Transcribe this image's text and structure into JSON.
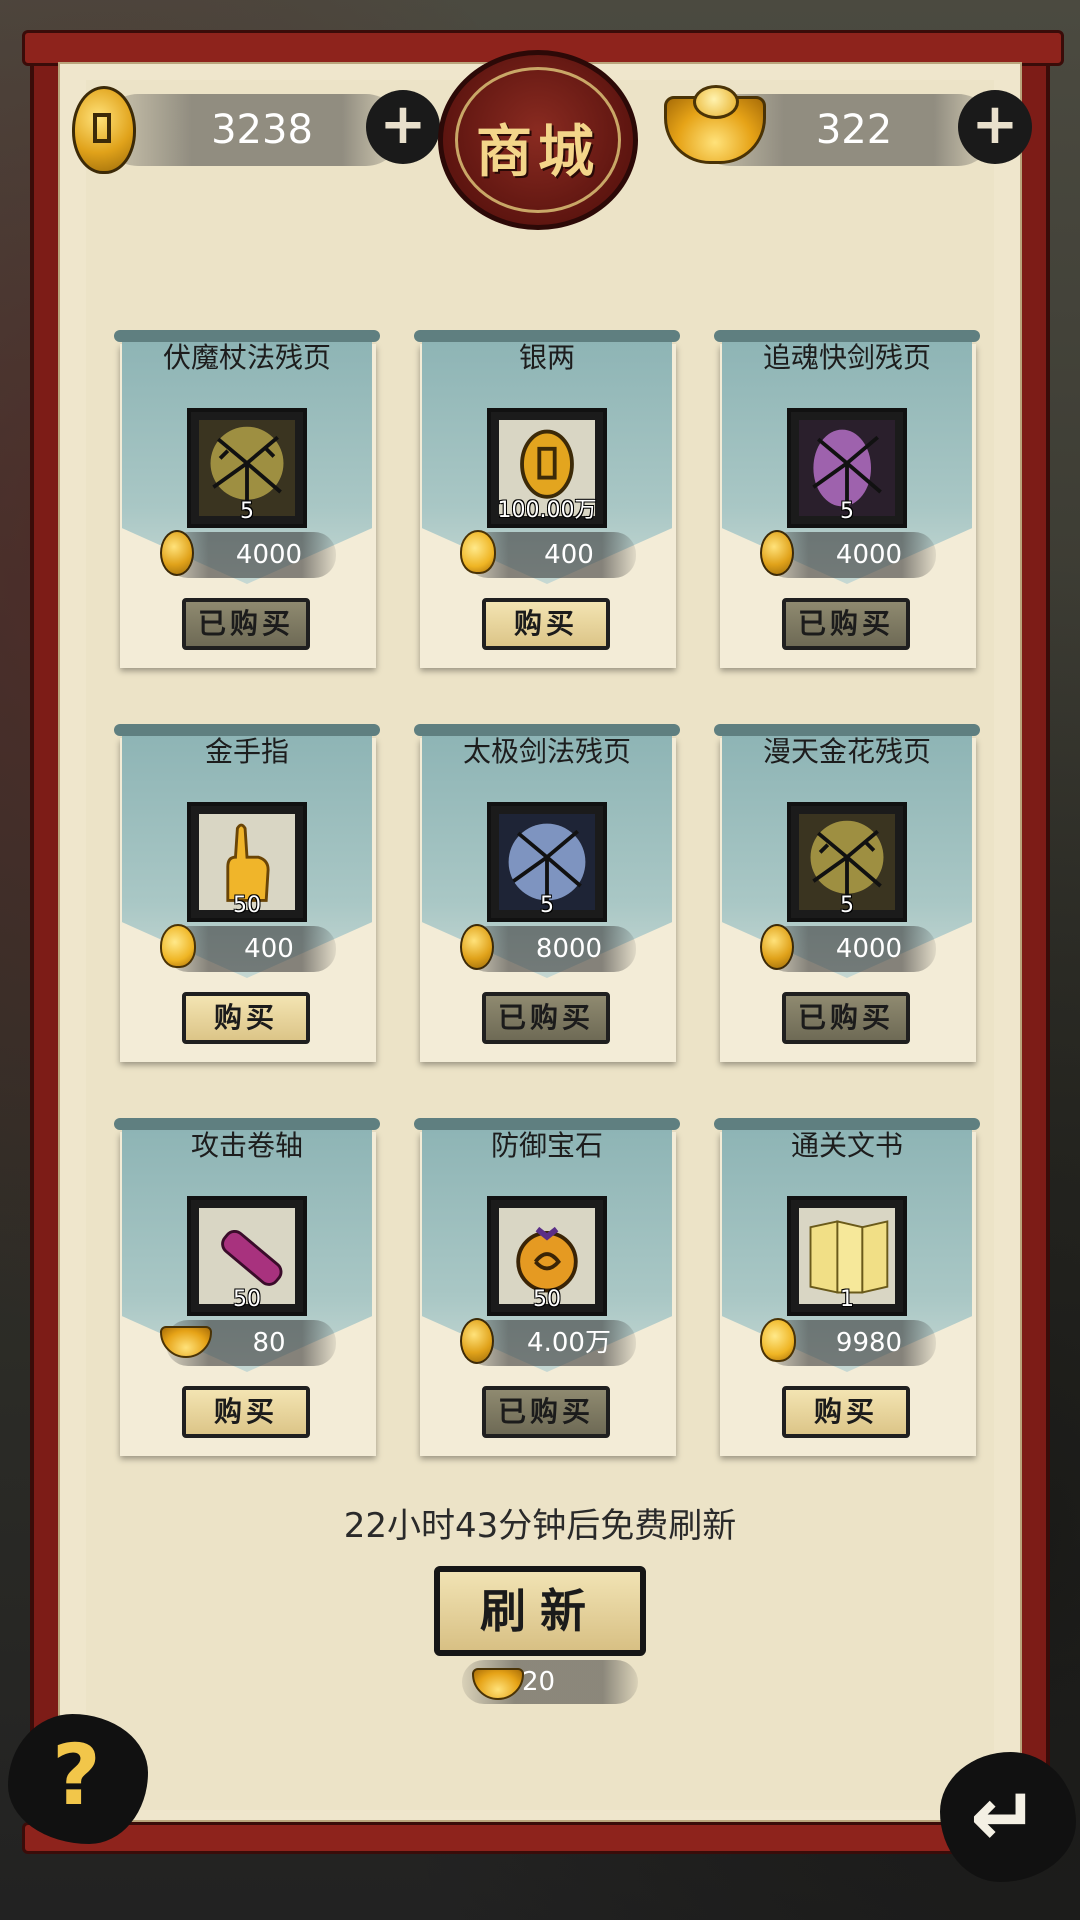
{
  "header": {
    "title": "商城",
    "coins": {
      "value": "3238",
      "icon": "copper-coin-icon",
      "add": "+"
    },
    "ingots": {
      "value": "322",
      "icon": "gold-ingot-icon",
      "add": "+"
    }
  },
  "items": [
    {
      "name": "伏魔杖法残页",
      "qty": "5",
      "price": "4000",
      "currency": "coin",
      "button": "已购买",
      "purchased": true,
      "art": "cracked-scroll-gold"
    },
    {
      "name": "银两",
      "qty": "100.00万",
      "price": "400",
      "currency": "gourd",
      "button": "购买",
      "purchased": false,
      "art": "coin"
    },
    {
      "name": "追魂快剑残页",
      "qty": "5",
      "price": "4000",
      "currency": "coin",
      "button": "已购买",
      "purchased": true,
      "art": "cracked-scroll-purple"
    },
    {
      "name": "金手指",
      "qty": "50",
      "price": "400",
      "currency": "gourd",
      "button": "购买",
      "purchased": false,
      "art": "golden-finger"
    },
    {
      "name": "太极剑法残页",
      "qty": "5",
      "price": "8000",
      "currency": "coin",
      "button": "已购买",
      "purchased": true,
      "art": "cracked-scroll-blue"
    },
    {
      "name": "漫天金花残页",
      "qty": "5",
      "price": "4000",
      "currency": "coin",
      "button": "已购买",
      "purchased": true,
      "art": "cracked-scroll-gold"
    },
    {
      "name": "攻击卷轴",
      "qty": "50",
      "price": "80",
      "currency": "ingot",
      "button": "购买",
      "purchased": false,
      "art": "purple-scroll"
    },
    {
      "name": "防御宝石",
      "qty": "50",
      "price": "4.00万",
      "currency": "coin",
      "button": "已购买",
      "purchased": true,
      "art": "gem-pouch"
    },
    {
      "name": "通关文书",
      "qty": "1",
      "price": "9980",
      "currency": "gourd",
      "button": "购买",
      "purchased": false,
      "art": "document"
    }
  ],
  "footer": {
    "refresh_note": "22小时43分钟后免费刷新",
    "refresh_label": "刷新",
    "refresh_cost": "20",
    "help": "?",
    "back": "↵"
  },
  "colors": {
    "frame": "#7d1c17",
    "parchment": "#efe6cc",
    "banner": "#9fbfbe",
    "button_buy": "#e8d69f",
    "button_sold": "#807b62"
  }
}
